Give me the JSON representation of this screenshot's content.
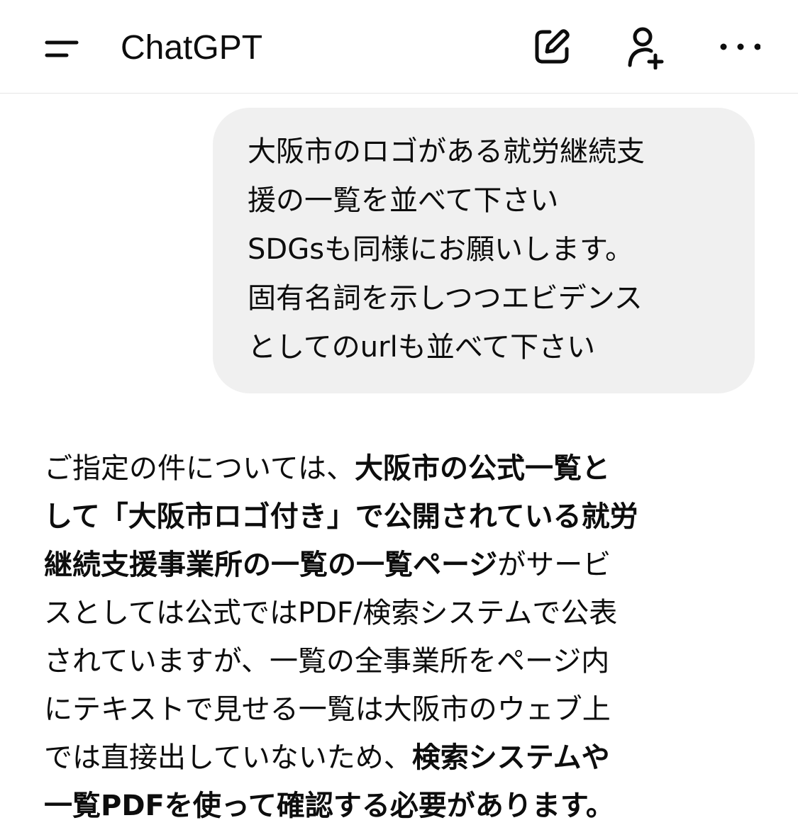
{
  "header": {
    "title": "ChatGPT",
    "icons": {
      "menu": "menu-icon",
      "new_chat": "edit-icon",
      "add_people": "add-person-icon",
      "more": "more-horizontal-icon"
    }
  },
  "user_message": {
    "lines": [
      "大阪市のロゴがある就労継続支",
      "援の一覧を並べて下さい",
      "SDGsも同様にお願いします。",
      "固有名詞を示しつつエビデンス",
      "としてのurlも並べて下さい"
    ]
  },
  "assistant_message": {
    "lines": [
      [
        {
          "text": "ご指定の件については、",
          "bold": false
        },
        {
          "text": "大阪市の公式一覧と",
          "bold": true
        }
      ],
      [
        {
          "text": "して「大阪市ロゴ付き」で公開されている就労",
          "bold": true
        }
      ],
      [
        {
          "text": "継続支援事業所の一覧の一覧ページ",
          "bold": true
        },
        {
          "text": "がサービ",
          "bold": false
        }
      ],
      [
        {
          "text": "スとしては公式ではPDF/検索システムで公表",
          "bold": false
        }
      ],
      [
        {
          "text": "されていますが、一覧の全事業所をページ内",
          "bold": false
        }
      ],
      [
        {
          "text": "にテキストで見せる一覧は大阪市のウェブ上",
          "bold": false
        }
      ],
      [
        {
          "text": "では直接出していないため、",
          "bold": false
        },
        {
          "text": "検索システムや",
          "bold": true
        }
      ],
      [
        {
          "text": "一覧PDFを使って確認する必要があります。",
          "bold": true
        }
      ]
    ]
  },
  "colors": {
    "text": "#0d0d0d",
    "bubble": "#f0f0f0",
    "divider": "#e6e6e6",
    "background": "#ffffff"
  }
}
